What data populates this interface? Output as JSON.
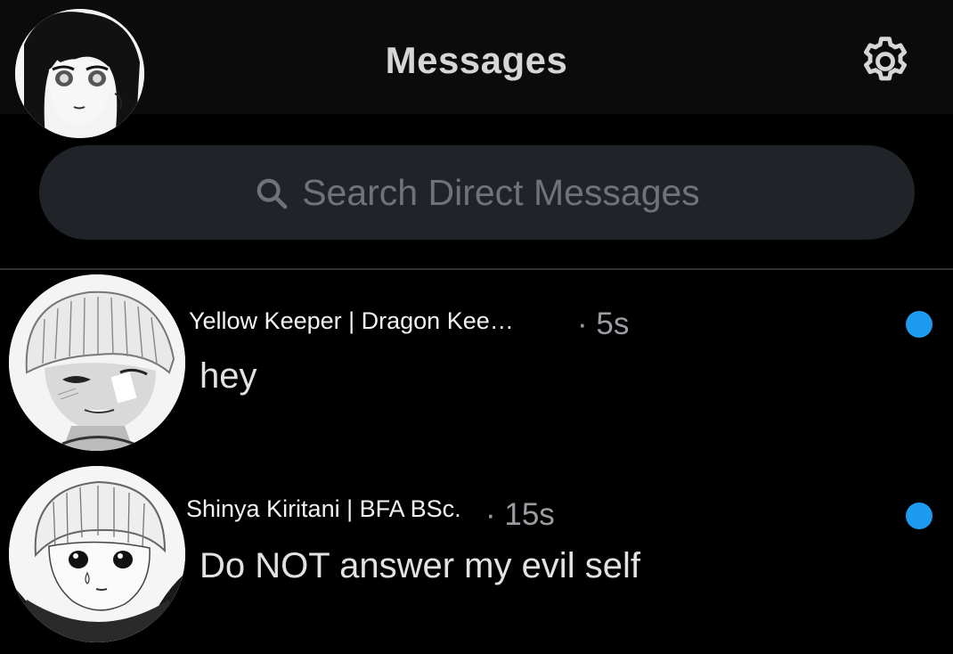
{
  "header": {
    "title": "Messages",
    "profile_avatar_icon": "manga-girl-portrait",
    "settings_icon": "gear-icon"
  },
  "search": {
    "placeholder": "Search Direct Messages",
    "icon": "search-icon"
  },
  "conversations": [
    {
      "name": "Yellow Keeper | Dragon Kee…",
      "time": "· 5s",
      "preview": "hey",
      "unread": true,
      "avatar_icon": "manga-boy-portrait"
    },
    {
      "name": "Shinya Kiritani | BFA BSc.",
      "time": "· 15s",
      "preview": "Do NOT answer my evil self",
      "unread": true,
      "avatar_icon": "manga-boy-portrait"
    }
  ],
  "colors": {
    "background": "#000000",
    "header_bg": "#0b0b0c",
    "search_bg": "#202327",
    "accent_unread": "#1d9bf0",
    "divider": "#2f3336"
  }
}
